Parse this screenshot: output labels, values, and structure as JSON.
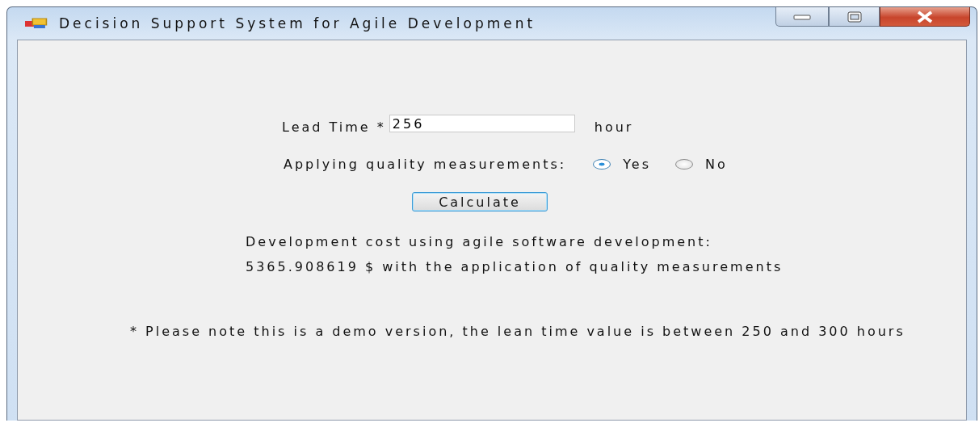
{
  "window": {
    "title": "Decision Support System for Agile Development"
  },
  "lead_time": {
    "label": "Lead Time *",
    "value": "256",
    "unit": "hour"
  },
  "quality": {
    "label": "Applying quality measurements:",
    "options": [
      {
        "label": "Yes",
        "selected": true
      },
      {
        "label": "No",
        "selected": false
      }
    ]
  },
  "calculate_button": "Calculate",
  "result": [
    "Development cost using agile software development:",
    "5365.908619 $ with the application of quality measurements"
  ],
  "note": "* Please note this is a demo version, the lean time value is between 250 and 300 hours"
}
